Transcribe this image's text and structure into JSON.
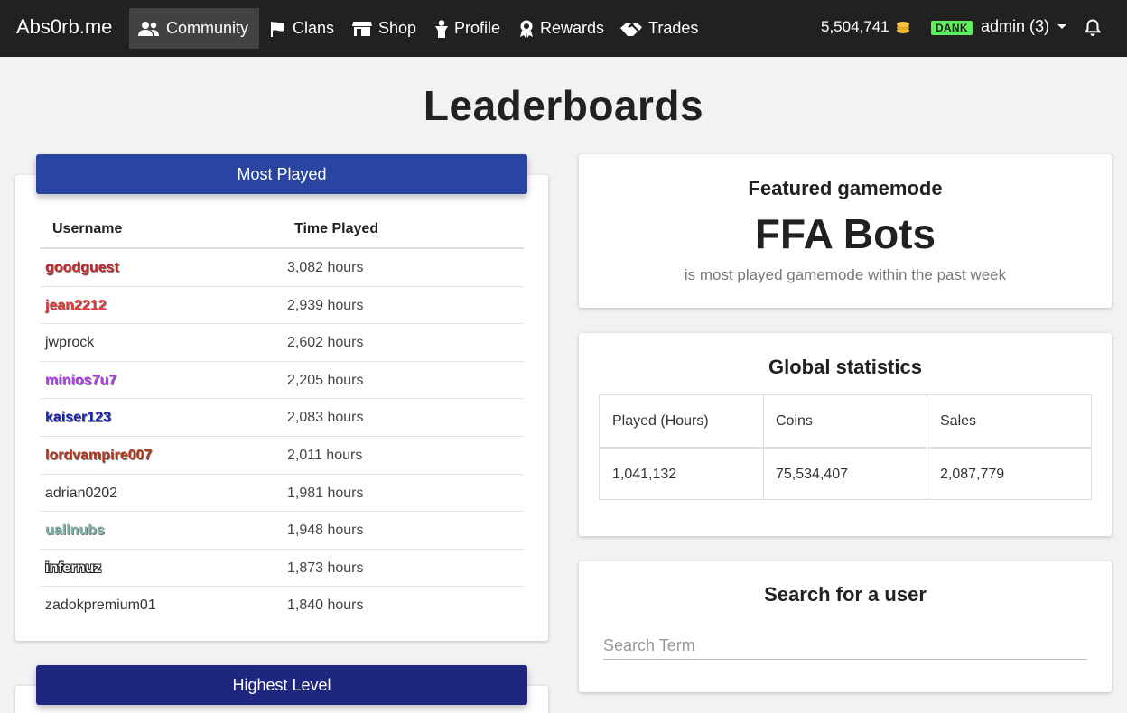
{
  "nav": {
    "brand": "Abs0rb.me",
    "items": [
      {
        "label": "Community",
        "icon": "users-icon",
        "active": true
      },
      {
        "label": "Clans",
        "icon": "flag-icon"
      },
      {
        "label": "Shop",
        "icon": "store-icon"
      },
      {
        "label": "Profile",
        "icon": "user-icon"
      },
      {
        "label": "Rewards",
        "icon": "award-icon"
      },
      {
        "label": "Trades",
        "icon": "handshake-icon"
      }
    ],
    "coins": "5,504,741",
    "badge": "DANK",
    "user": "admin (3)"
  },
  "page_title": "Leaderboards",
  "most_played": {
    "title": "Most Played",
    "columns": [
      "Username",
      "Time Played"
    ],
    "rows": [
      {
        "name": "goodguest",
        "time": "3,082 hours",
        "color": "#c62828",
        "style": "fancy"
      },
      {
        "name": "jean2212",
        "time": "2,939 hours",
        "color": "#e53935",
        "style": "fancy"
      },
      {
        "name": "jwprock",
        "time": "2,602 hours",
        "color": "#333333",
        "style": "plain"
      },
      {
        "name": "minios7u7",
        "time": "2,205 hours",
        "color": "#b23cf0",
        "style": "fancy"
      },
      {
        "name": "kaiser123",
        "time": "2,083 hours",
        "color": "#1a23b8",
        "style": "fancy"
      },
      {
        "name": "lordvampire007",
        "time": "2,011 hours",
        "color": "#b5341a",
        "style": "fancy"
      },
      {
        "name": "adrian0202",
        "time": "1,981 hours",
        "color": "#333333",
        "style": "plain"
      },
      {
        "name": "uallnubs",
        "time": "1,948 hours",
        "color": "#7fb5a8",
        "style": "fancy"
      },
      {
        "name": "infernuz",
        "time": "1,873 hours",
        "color": "#f5f5f5",
        "style": "outline"
      },
      {
        "name": "zadokpremium01",
        "time": "1,840 hours",
        "color": "#333333",
        "style": "plain"
      }
    ]
  },
  "highest_level": {
    "title": "Highest Level"
  },
  "featured": {
    "label": "Featured gamemode",
    "mode": "FFA Bots",
    "desc": "is most played gamemode within the past week"
  },
  "global_stats": {
    "title": "Global statistics",
    "headers": [
      "Played (Hours)",
      "Coins",
      "Sales"
    ],
    "values": [
      "1,041,132",
      "75,534,407",
      "2,087,779"
    ]
  },
  "search": {
    "title": "Search for a user",
    "placeholder": "Search Term"
  },
  "colors": {
    "navbar": "#212121",
    "card_header_most_played": "#2a45a1",
    "card_header_highest_level": "#1f2680",
    "badge": "#5ef05e",
    "coin": "#f5c542"
  }
}
